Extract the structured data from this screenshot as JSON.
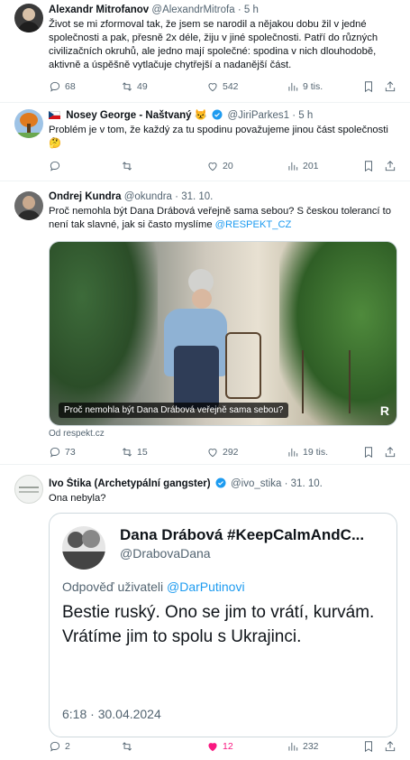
{
  "colors": {
    "accent": "#1d9bf0",
    "like": "#f91880",
    "muted": "#536471",
    "border": "#eff3f4"
  },
  "tweets": [
    {
      "name": "Alexandr Mitrofanov",
      "handle": "@AlexandrMitrofa",
      "dot": "·",
      "time": "5 h",
      "text": "Život se mi zformoval tak, že jsem se narodil a nějakou dobu žil v jedné společnosti a pak, přesně 2x déle, žiju v jiné společnosti. Patří do různých civilizačních okruhů, ale jedno mají společné: spodina v nich dlouhodobě, aktivně a úspěšně vytlačuje chytřejší a nadanější část.",
      "replies": "68",
      "retweets": "49",
      "likes": "542",
      "views": "9 tis."
    },
    {
      "name": "Nosey George - Naštvaný",
      "emoji": "😾",
      "handle": "@JiriParkes1",
      "dot": "·",
      "time": "5 h",
      "text": "Problém je v tom, že každý za tu spodinu považujeme jinou část společnosti",
      "text_emoji": "🤔",
      "replies": "",
      "retweets": "",
      "likes": "20",
      "views": "201"
    },
    {
      "name": "Ondrej Kundra",
      "handle": "@okundra",
      "dot": "·",
      "time": "31. 10.",
      "text": "Proč nemohla být Dana Drábová veřejně sama sebou? S českou tolerancí to není tak slavné, jak si často myslíme",
      "mention": "@RESPEKT_CZ",
      "media_caption": "Proč nemohla být Dana Drábová veřejně sama sebou?",
      "media_logo": "R",
      "source": "Od respekt.cz",
      "replies": "73",
      "retweets": "15",
      "likes": "292",
      "views": "19 tis."
    },
    {
      "name": "Ivo Štika (Archetypální gangster)",
      "handle": "@ivo_stika",
      "dot": "·",
      "time": "31. 10.",
      "text": "Ona nebyla?",
      "replies": "2",
      "retweets": "",
      "likes": "12",
      "views": "232"
    }
  ],
  "quote": {
    "name": "Dana Drábová #KeepCalmAndC...",
    "handle": "@DrabovaDana",
    "reply_prefix": "Odpověď uživateli",
    "reply_to": "@DarPutinovi",
    "text": "Bestie ruský. Ono se jim to vrátí, kurvám. Vrátíme jim to spolu s Ukrajinci.",
    "time": "6:18 · 30.04.2024"
  },
  "icons": {
    "reply": "reply-icon",
    "retweet": "retweet-icon",
    "like": "like-icon",
    "views": "views-icon",
    "bookmark": "bookmark-icon",
    "share": "share-icon",
    "verified": "verified-badge-icon"
  }
}
